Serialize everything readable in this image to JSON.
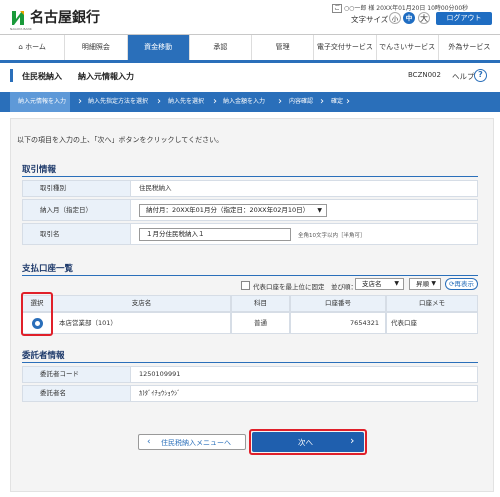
{
  "header": {
    "bank_name": "名古屋銀行",
    "logo_sub": "NAGOYA BANK",
    "user_prefix": "ご",
    "user_name": "○○一郎 様",
    "login_info": "20XX年01月20日 10時00分00秒",
    "text_size_label": "文字サイズ",
    "size_small": "小",
    "size_mid": "中",
    "size_large": "大",
    "logout": "ログアウト"
  },
  "nav": {
    "home": "ホーム",
    "items": [
      "明細照会",
      "資金移動",
      "承認",
      "管理",
      "電子交付サービス",
      "でんさいサービス",
      "外為サービス"
    ]
  },
  "page": {
    "title": "住民税納入　　納入元情報入力",
    "screen_id": "BCZN002",
    "help": "ヘルプ"
  },
  "steps": [
    "納入元情報を入力",
    "納入先指定方法を選択",
    "納入先を選択",
    "納入金額を入力",
    "内容確認",
    "確定"
  ],
  "instruction": "以下の項目を入力の上、「次へ」ボタンをクリックしてください。",
  "torihiki": {
    "title": "取引情報",
    "rows": [
      {
        "label": "取引種別",
        "value": "住民税納入"
      },
      {
        "label": "納入月（指定日）",
        "value": "納付月：20XX年01月分（指定日：20XX年02月10日）"
      },
      {
        "label": "取引名",
        "value": "１月分住民税納入１",
        "hint": "全角10文字以内［半角可］"
      }
    ]
  },
  "accounts": {
    "title": "支払口座一覧",
    "pin_label": "代表口座を最上位に固定",
    "sort_label": "並び順：",
    "sort_value": "支店名",
    "order_value": "昇順",
    "redisplay": "再表示",
    "columns": [
      "選択",
      "支店名",
      "科目",
      "口座番号",
      "口座メモ"
    ],
    "rows": [
      {
        "branch": "本店営業部（101）",
        "type": "普通",
        "number": "7654321",
        "memo": "代表口座"
      }
    ]
  },
  "itakusha": {
    "title": "委託者情報",
    "rows": [
      {
        "label": "委託者コード",
        "value": "1250109991"
      },
      {
        "label": "委託者名",
        "value": "ｶ)ﾀﾞｲﾁｮｳｼｮｳｼﾞ"
      }
    ]
  },
  "buttons": {
    "back": "住民税納入メニューへ",
    "next": "次へ"
  },
  "colors": {
    "primary": "#2a6fba",
    "highlight": "#e0202a"
  }
}
